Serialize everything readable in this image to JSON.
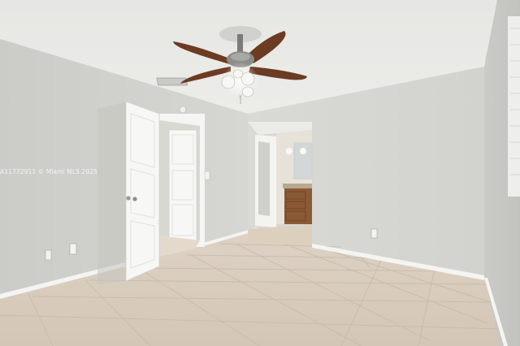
{
  "photo": {
    "watermark": "A11772911 © Miami MLS 2025"
  }
}
